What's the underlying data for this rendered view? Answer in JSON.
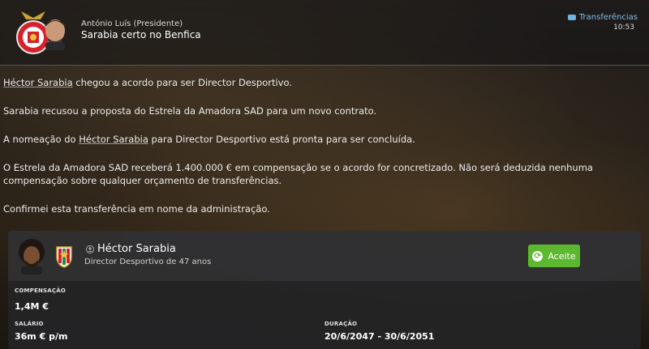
{
  "header": {
    "sender": "António Luís (Presidente)",
    "subject": "Sarabia certo no Benfica",
    "tag": "Transferências",
    "time": "10:53"
  },
  "message": {
    "p1_name": "Héctor Sarabia",
    "p1_rest": " chegou a acordo para ser Director Desportivo.",
    "p2": "Sarabia recusou a proposta do Estrela da Amadora SAD para um novo contrato.",
    "p3_pre": "A nomeação do ",
    "p3_name": "Héctor Sarabia",
    "p3_post": " para Director Desportivo está pronta para ser concluída.",
    "p4": "O Estrela da Amadora SAD receberá 1.400.000 € em compensação se o acordo for concretizado. Não será deduzida nenhuma compensação sobre qualquer orçamento de transferências.",
    "p5": "Confirmei esta transferência em nome da administração."
  },
  "card": {
    "name": "Héctor Sarabia",
    "role": "Director Desportivo de 47 anos",
    "accept_label": "Aceite",
    "compensation_label": "COMPENSAÇÃO",
    "compensation_value": "1,4M €",
    "salary_label": "SALÁRIO",
    "salary_value": "36m € p/m",
    "duration_label": "DURAÇÃO",
    "duration_value": "20/6/2047 - 30/6/2051"
  },
  "colors": {
    "accept_green": "#5cb82e",
    "tag_blue": "#7fbfe6",
    "benfica_red": "#d6202b"
  },
  "icons": [
    "benfica-crest-icon",
    "president-avatar-icon",
    "transfer-tag-icon",
    "person-face-icon",
    "estrela-crest-icon",
    "staff-icon",
    "refresh-icon"
  ]
}
